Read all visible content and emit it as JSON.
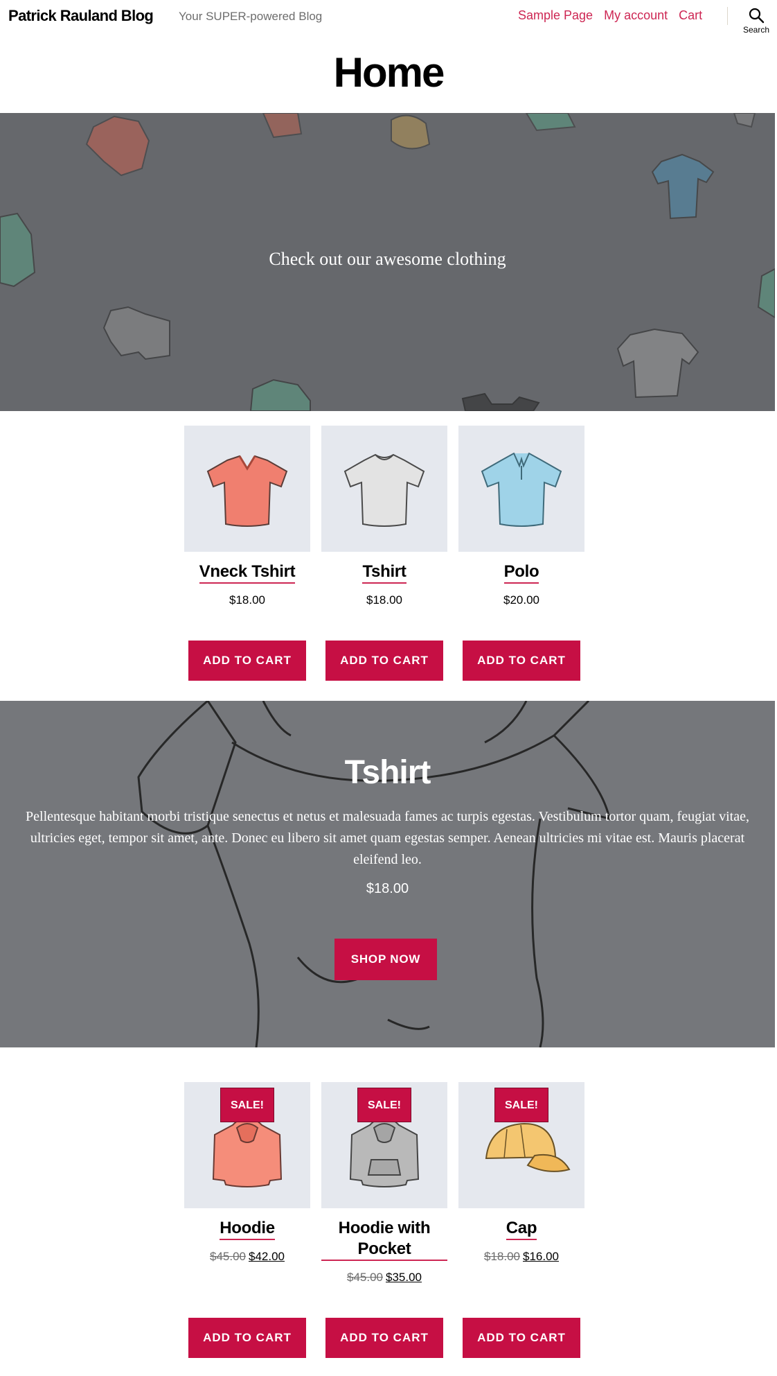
{
  "header": {
    "site_title": "Patrick Rauland Blog",
    "site_description": "Your SUPER-powered Blog",
    "nav": [
      {
        "label": "Sample Page"
      },
      {
        "label": "My account"
      },
      {
        "label": "Cart"
      }
    ],
    "search_label": "Search"
  },
  "page": {
    "title": "Home"
  },
  "cover": {
    "text": "Check out our awesome clothing"
  },
  "products_top": [
    {
      "title": "Vneck Tshirt",
      "price": "$18.00",
      "button": "ADD TO CART",
      "color": "#f07f6f"
    },
    {
      "title": "Tshirt",
      "price": "$18.00",
      "button": "ADD TO CART",
      "color": "#e3e3e3"
    },
    {
      "title": "Polo",
      "price": "$20.00",
      "button": "ADD TO CART",
      "color": "#9fd3e8"
    }
  ],
  "featured": {
    "title": "Tshirt",
    "description": "Pellentesque habitant morbi tristique senectus et netus et malesuada fames ac turpis egestas. Vestibulum tortor quam, feugiat vitae, ultricies eget, tempor sit amet, ante. Donec eu libero sit amet quam egestas semper. Aenean ultricies mi vitae est. Mauris placerat eleifend leo.",
    "price": "$18.00",
    "button": "SHOP NOW"
  },
  "products_sale": [
    {
      "title": "Hoodie",
      "badge": "SALE!",
      "old_price": "$45.00",
      "price": "$42.00",
      "button": "ADD TO CART",
      "color": "#f58d7a"
    },
    {
      "title": "Hoodie with Pocket",
      "badge": "SALE!",
      "old_price": "$45.00",
      "price": "$35.00",
      "button": "ADD TO CART",
      "color": "#b9b9b9"
    },
    {
      "title": "Cap",
      "badge": "SALE!",
      "old_price": "$18.00",
      "price": "$16.00",
      "button": "ADD TO CART",
      "color": "#f4c670"
    }
  ],
  "colors": {
    "accent": "#cd2653",
    "button": "#c60f44",
    "cover_overlay": "#66686c"
  }
}
